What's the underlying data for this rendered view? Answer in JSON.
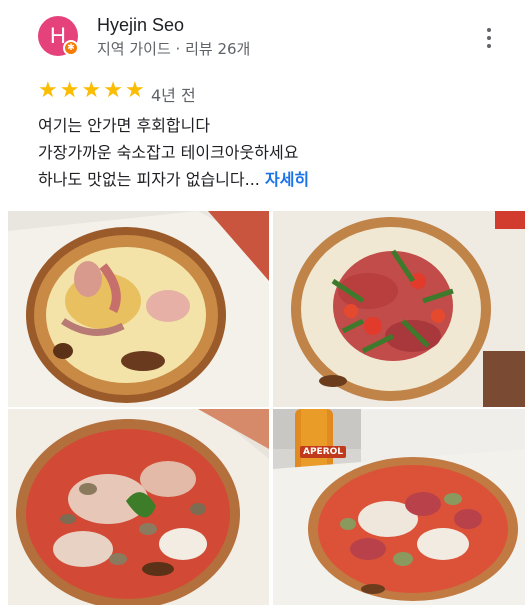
{
  "reviewer": {
    "initial": "H",
    "name": "Hyejin Seo",
    "meta": "지역 가이드 · 리뷰 26개"
  },
  "review": {
    "rating": 5,
    "star_glyph": "★",
    "time_ago": "4년 전",
    "lines": [
      "여기는 안가면 후회합니다",
      "가장가까운 숙소잡고 테이크아웃하세요",
      "하나도 맛없는 피자가 없습니다..."
    ],
    "more_label": "자세히"
  },
  "photos": [
    {
      "name": "photo-pizza-ham-cheese",
      "description_icon": "pizza-photo"
    },
    {
      "name": "photo-pizza-prosciutto-arugula",
      "description_icon": "pizza-photo"
    },
    {
      "name": "photo-pizza-mushroom-basil",
      "description_icon": "pizza-photo"
    },
    {
      "name": "photo-pizza-salami-artichoke",
      "bottle_text": "APEROL"
    }
  ],
  "colors": {
    "avatar": "#e5417a",
    "badge": "#f57c00",
    "star": "#fbbc04",
    "link": "#1a73e8"
  }
}
